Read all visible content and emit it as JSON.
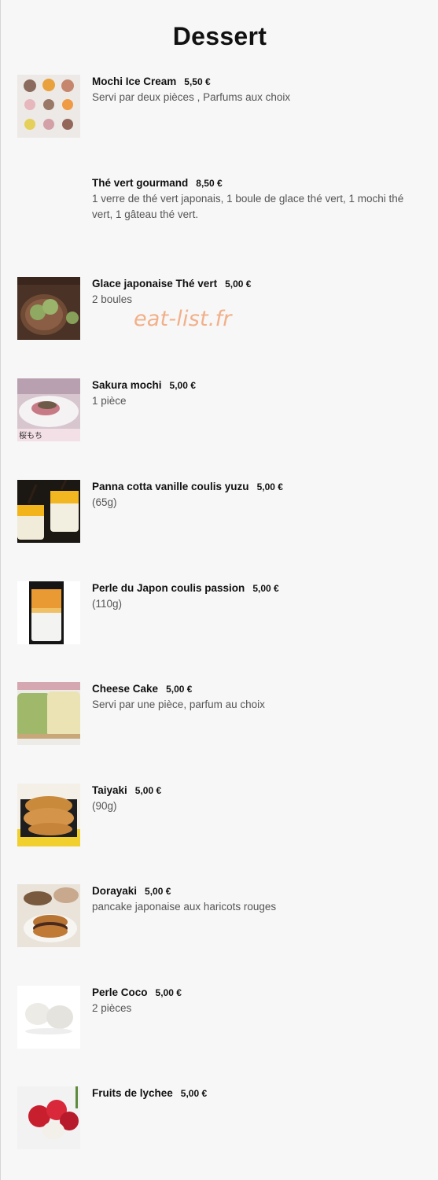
{
  "header": {
    "title": "Dessert"
  },
  "watermark": "eat-list.fr",
  "items": [
    {
      "name": "Mochi Ice Cream",
      "price": "5,50 €",
      "description": "Servi par deux pièces , Parfums aux choix",
      "image": "mochi-ice-cream-image"
    },
    {
      "name": "Thé vert gourmand",
      "price": "8,50 €",
      "description": "1 verre de thé vert japonais, 1 boule de glace thé vert, 1 mochi thé vert, 1 gâteau thé vert.",
      "image": ""
    },
    {
      "name": "Glace japonaise Thé vert",
      "price": "5,00 €",
      "description": "2 boules",
      "image": "green-tea-ice-cream-image"
    },
    {
      "name": "Sakura mochi",
      "price": "5,00 €",
      "description": "1 pièce",
      "image": "sakura-mochi-image"
    },
    {
      "name": "Panna cotta vanille coulis yuzu",
      "price": "5,00 €",
      "description": "(65g)",
      "image": "panna-cotta-image"
    },
    {
      "name": "Perle du Japon coulis passion",
      "price": "5,00 €",
      "description": "(110g)",
      "image": "perle-du-japon-image"
    },
    {
      "name": "Cheese Cake",
      "price": "5,00 €",
      "description": "Servi par une pièce, parfum au choix",
      "image": "cheese-cake-image"
    },
    {
      "name": "Taiyaki",
      "price": "5,00 €",
      "description": "(90g)",
      "image": "taiyaki-image"
    },
    {
      "name": "Dorayaki",
      "price": "5,00 €",
      "description": "pancake japonaise aux haricots rouges",
      "image": "dorayaki-image"
    },
    {
      "name": "Perle Coco",
      "price": "5,00 €",
      "description": "2 pièces",
      "image": "perle-coco-image"
    },
    {
      "name": "Fruits de lychee",
      "price": "5,00 €",
      "description": "",
      "image": "lychee-image"
    }
  ],
  "thumbnail_labels": {
    "sakura": "桜もち"
  }
}
